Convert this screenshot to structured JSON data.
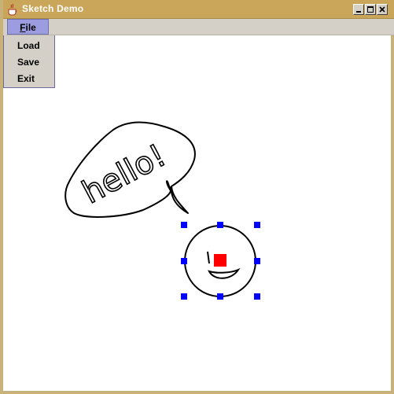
{
  "window": {
    "title": "Sketch Demo"
  },
  "title_buttons": [
    "minimize",
    "maximize",
    "close"
  ],
  "menubar": {
    "file_label": "File",
    "file_mnemonic": "F",
    "file_rest": "ile"
  },
  "file_menu": {
    "items": [
      "Load",
      "Save",
      "Exit"
    ]
  },
  "drawing": {
    "speech_text": "hello!",
    "selection_color": "#0000ff",
    "anchor_color": "#ff0000"
  },
  "colors": {
    "titlebar": "#c9a65a",
    "menu_highlight": "#9c9ce0",
    "canvas": "#ffffff"
  }
}
